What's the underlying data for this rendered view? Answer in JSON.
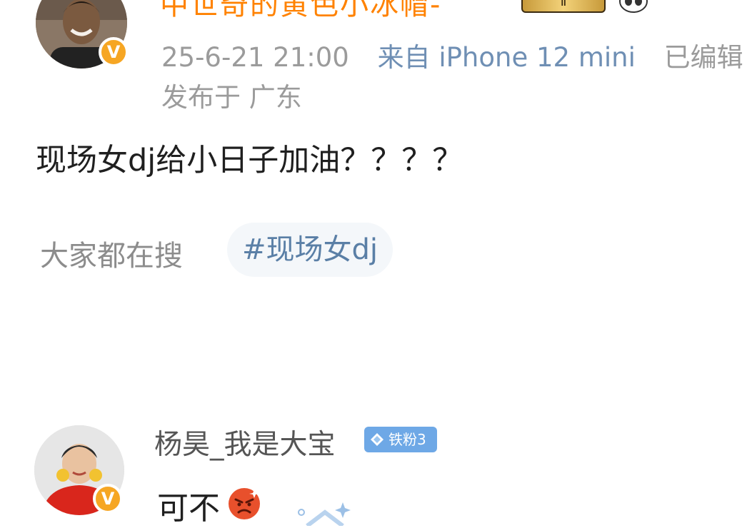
{
  "post": {
    "username": "中世奇的黄色小冰帽-",
    "fan_badge": "Ⅱ",
    "timestamp": "25-6-21 21:00",
    "source": "来自 iPhone 12 mini",
    "edited": "已编辑",
    "location": "发布于 广东",
    "content": "现场女dj给小日子加油？？？？",
    "verify_mark": "V",
    "avatar_icon": "user-avatar",
    "panda_icon": "panda-emoji-icon"
  },
  "trending": {
    "label": "大家都在搜",
    "topic": "#现场女dj"
  },
  "comment": {
    "username": "杨昊_我是大宝",
    "fan_badge": "铁粉3",
    "content": "可不",
    "emoji_icon": "angry-face-icon",
    "verify_mark": "V"
  },
  "colors": {
    "username_top": "#ff8200",
    "meta_gray": "#9b9b9b",
    "device_blue": "#6f8fb4",
    "topic_blue": "#5a7fa6",
    "badge_blue": "#6ea8e6",
    "verify_orange": "#f6a623"
  }
}
